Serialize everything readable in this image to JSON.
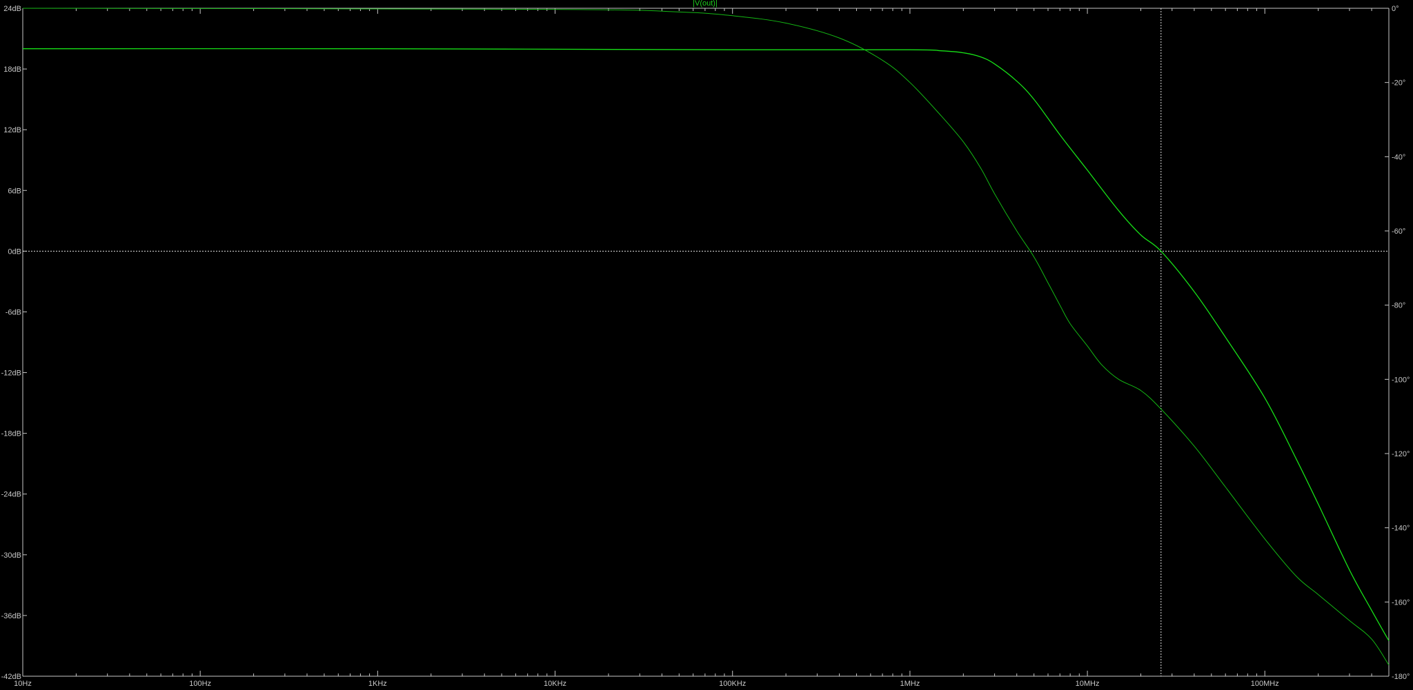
{
  "chart_data": {
    "type": "line",
    "title": "|V(out)|",
    "x_scale": "log",
    "xlim": [
      10,
      500000000
    ],
    "ylim": [
      -42,
      24
    ],
    "y2lim": [
      -180,
      0
    ],
    "x_ticks": [
      {
        "value": 10,
        "label": "10Hz"
      },
      {
        "value": 100,
        "label": "100Hz"
      },
      {
        "value": 1000,
        "label": "1KHz"
      },
      {
        "value": 10000,
        "label": "10KHz"
      },
      {
        "value": 100000,
        "label": "100KHz"
      },
      {
        "value": 1000000,
        "label": "1MHz"
      },
      {
        "value": 10000000,
        "label": "10MHz"
      },
      {
        "value": 100000000,
        "label": "100MHz"
      }
    ],
    "y_ticks": [
      {
        "value": 24,
        "label": "24dB"
      },
      {
        "value": 18,
        "label": "18dB"
      },
      {
        "value": 12,
        "label": "12dB"
      },
      {
        "value": 6,
        "label": "6dB"
      },
      {
        "value": 0,
        "label": "0dB"
      },
      {
        "value": -6,
        "label": "-6dB"
      },
      {
        "value": -12,
        "label": "-12dB"
      },
      {
        "value": -18,
        "label": "-18dB"
      },
      {
        "value": -24,
        "label": "-24dB"
      },
      {
        "value": -30,
        "label": "-30dB"
      },
      {
        "value": -36,
        "label": "-36dB"
      },
      {
        "value": -42,
        "label": "-42dB"
      }
    ],
    "y2_ticks": [
      {
        "value": 0,
        "label": "0°"
      },
      {
        "value": -20,
        "label": "-20°"
      },
      {
        "value": -40,
        "label": "-40°"
      },
      {
        "value": -60,
        "label": "-60°"
      },
      {
        "value": -80,
        "label": "-80°"
      },
      {
        "value": -100,
        "label": "-100°"
      },
      {
        "value": -120,
        "label": "-120°"
      },
      {
        "value": -140,
        "label": "-140°"
      },
      {
        "value": -160,
        "label": "-160°"
      },
      {
        "value": -180,
        "label": "-180°"
      }
    ],
    "grid": false,
    "cursor": {
      "x": 26000000,
      "y": 0
    },
    "series": [
      {
        "axis": "left",
        "color": "#17e017",
        "points": [
          [
            10,
            20.0
          ],
          [
            1000,
            20.0
          ],
          [
            100000,
            19.9
          ],
          [
            1000000,
            19.9
          ],
          [
            1500000,
            19.8
          ],
          [
            2000000,
            19.6
          ],
          [
            2500000,
            19.2
          ],
          [
            3000000,
            18.5
          ],
          [
            4000000,
            16.8
          ],
          [
            5000000,
            15.0
          ],
          [
            7000000,
            11.5
          ],
          [
            10000000,
            8.0
          ],
          [
            15000000,
            4.0
          ],
          [
            20000000,
            1.6
          ],
          [
            26000000,
            0.0
          ],
          [
            40000000,
            -4.0
          ],
          [
            60000000,
            -8.5
          ],
          [
            100000000,
            -14.5
          ],
          [
            150000000,
            -20.5
          ],
          [
            200000000,
            -25.0
          ],
          [
            300000000,
            -31.5
          ],
          [
            400000000,
            -35.5
          ],
          [
            500000000,
            -38.5
          ]
        ]
      },
      {
        "axis": "right",
        "color": "#14b814",
        "points": [
          [
            10,
            0
          ],
          [
            10000,
            -0.3
          ],
          [
            50000,
            -1
          ],
          [
            100000,
            -2
          ],
          [
            200000,
            -4
          ],
          [
            400000,
            -8
          ],
          [
            700000,
            -14
          ],
          [
            1000000,
            -20
          ],
          [
            1500000,
            -29
          ],
          [
            2000000,
            -36
          ],
          [
            2500000,
            -43
          ],
          [
            3000000,
            -50
          ],
          [
            4000000,
            -60
          ],
          [
            5000000,
            -67
          ],
          [
            6000000,
            -74
          ],
          [
            7000000,
            -80
          ],
          [
            8000000,
            -85
          ],
          [
            10000000,
            -91
          ],
          [
            12000000,
            -96
          ],
          [
            15000000,
            -100
          ],
          [
            20000000,
            -103
          ],
          [
            26000000,
            -108
          ],
          [
            40000000,
            -118
          ],
          [
            60000000,
            -129
          ],
          [
            100000000,
            -143
          ],
          [
            150000000,
            -153
          ],
          [
            200000000,
            -158
          ],
          [
            300000000,
            -165
          ],
          [
            400000000,
            -170
          ],
          [
            500000000,
            -177
          ]
        ]
      }
    ]
  }
}
